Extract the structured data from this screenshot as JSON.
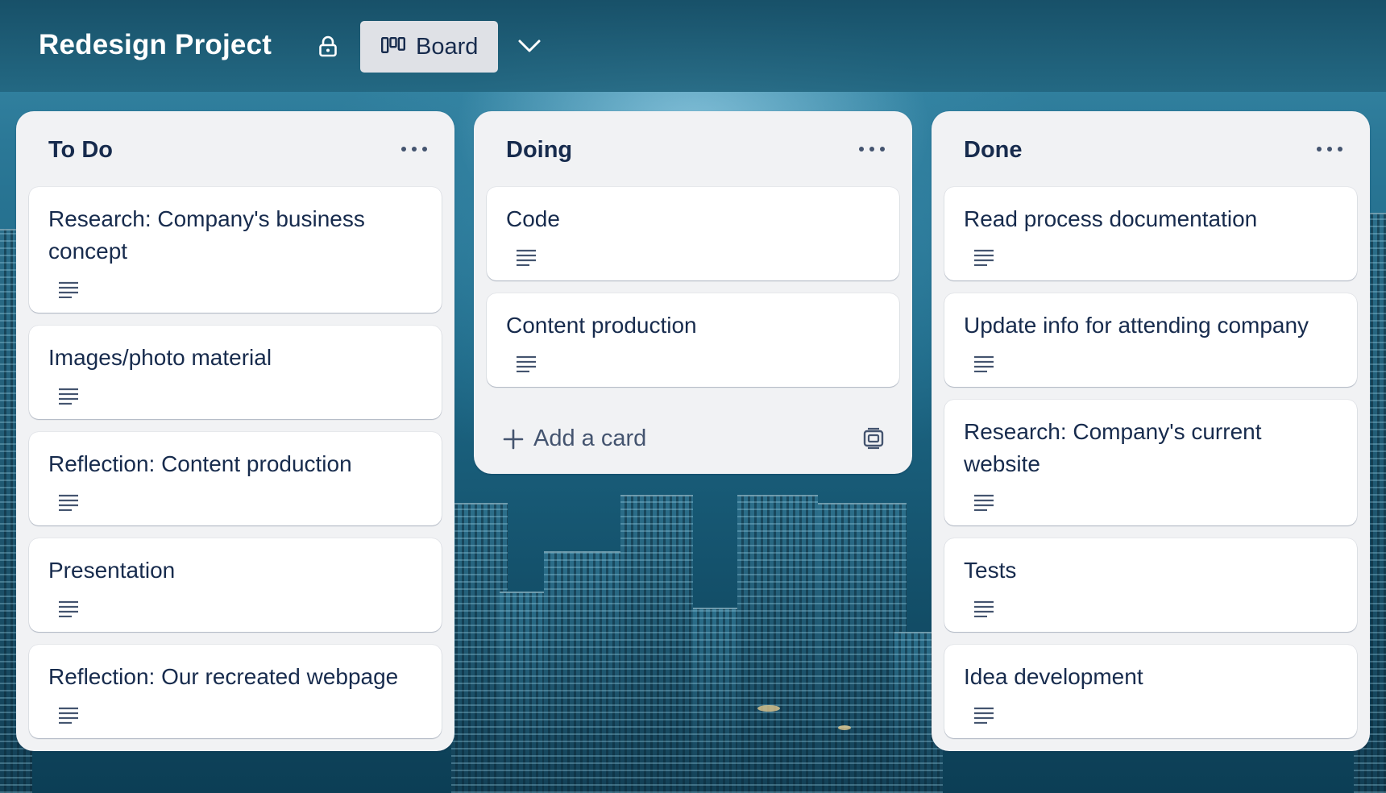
{
  "header": {
    "board_title": "Redesign Project",
    "view_label": "Board",
    "lock_icon": "lock-icon",
    "view_icon": "board-view-icon",
    "dropdown_icon": "chevron-down-icon"
  },
  "lists": [
    {
      "title": "To Do",
      "cards": [
        {
          "title": "Research: Company's business concept"
        },
        {
          "title": "Images/photo material"
        },
        {
          "title": "Reflection: Content production"
        },
        {
          "title": "Presentation"
        },
        {
          "title": "Reflection: Our recreated webpage"
        }
      ]
    },
    {
      "title": "Doing",
      "cards": [
        {
          "title": "Code"
        },
        {
          "title": "Content production"
        }
      ],
      "add_card_label": "Add a card"
    },
    {
      "title": "Done",
      "cards": [
        {
          "title": "Read process documentation"
        },
        {
          "title": "Update info for attending company"
        },
        {
          "title": "Research: Company's current website"
        },
        {
          "title": "Tests"
        },
        {
          "title": "Idea development"
        }
      ]
    }
  ],
  "colors": {
    "header_bg": "#1d5f7c",
    "list_bg": "#f1f2f4",
    "card_bg": "#ffffff",
    "text_primary": "#172b4d",
    "text_secondary": "#44546f",
    "button_bg": "#dfe1e6"
  }
}
